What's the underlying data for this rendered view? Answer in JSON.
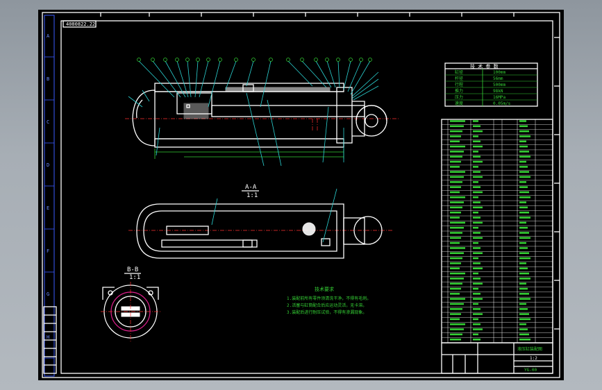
{
  "drawing": {
    "file_tag": "4080822.22",
    "section_a_label": "A-A",
    "section_b_label": "B-B",
    "section_scale": "1:1",
    "notes_title": "技术要求",
    "notes": [
      "1.装配前所有零件须清洗干净，不得有毛刺。",
      "2.活塞与缸筒配合后应运动灵活，无卡滞。",
      "3.装配后进行耐压试验，不得有渗漏现象。"
    ],
    "spec_table_title": "技 术 参 数",
    "spec_rows": [
      {
        "name": "缸径",
        "value": "100mm"
      },
      {
        "name": "杆径",
        "value": "56mm"
      },
      {
        "name": "行程",
        "value": "500mm"
      },
      {
        "name": "推力",
        "value": "98kN"
      },
      {
        "name": "压力",
        "value": "16MPa"
      },
      {
        "name": "速度",
        "value": "0.05m/s"
      }
    ],
    "parts_rows": 44,
    "title_block": {
      "name": "液压缸装配图",
      "scale": "1:2",
      "drawing_no": "YG-00"
    },
    "left_strip_labels": [
      "A",
      "B",
      "C",
      "D",
      "E",
      "F",
      "G",
      "H"
    ]
  },
  "colors": {
    "background": "#000000",
    "frame": "#ffffff",
    "leader": "#2bd3d3",
    "dimension": "#35d235",
    "centerline": "#ff3030",
    "ring": "#e0208e",
    "strip": "#3a5bff"
  }
}
